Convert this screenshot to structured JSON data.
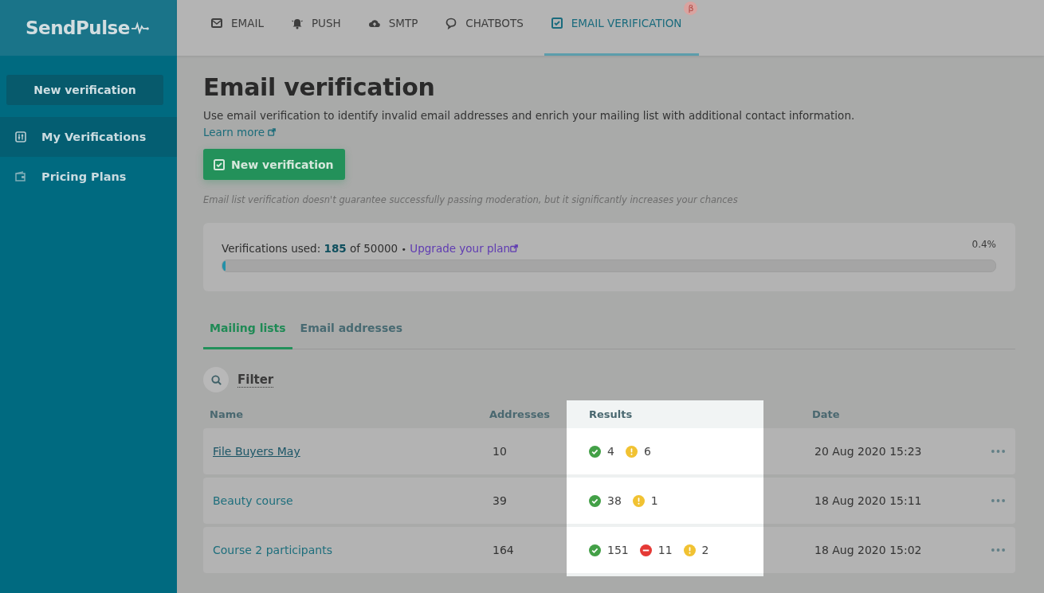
{
  "sidebar": {
    "logo": "SendPulse",
    "new_button": "New verification",
    "items": [
      {
        "label": "My Verifications",
        "selected": true
      },
      {
        "label": "Pricing Plans",
        "selected": false
      }
    ]
  },
  "top_nav": {
    "tabs": [
      {
        "label": "EMAIL",
        "selected": false
      },
      {
        "label": "PUSH",
        "selected": false
      },
      {
        "label": "SMTP",
        "selected": false
      },
      {
        "label": "CHATBOTS",
        "selected": false
      },
      {
        "label": "EMAIL VERIFICATION",
        "selected": true,
        "badge": "β"
      }
    ]
  },
  "page": {
    "title": "Email verification",
    "description": "Use email verification to identify invalid email addresses and enrich your mailing list with additional contact information.",
    "learn_more": "Learn more",
    "new_button": "New verification",
    "note": "Email list verification doesn't guarantee successfully passing moderation, but it significantly increases your chances"
  },
  "usage": {
    "label": "Verifications used:",
    "used": "185",
    "of": "of 50000",
    "separator": "•",
    "link": "Upgrade your plan",
    "percent": "0.4%",
    "level": 0.004
  },
  "tabs": [
    {
      "label": "Mailing lists",
      "selected": true
    },
    {
      "label": "Email addresses",
      "selected": false
    }
  ],
  "filter": "Filter",
  "table": {
    "columns": [
      "Name",
      "Addresses",
      "Results",
      "Date"
    ],
    "rows": [
      {
        "name": "File Buyers May",
        "hovered": true,
        "addresses": "10",
        "results": [
          {
            "kind": "valid",
            "count": "4"
          },
          {
            "kind": "risky",
            "count": "6"
          }
        ],
        "date": "20 Aug 2020 15:23"
      },
      {
        "name": "Beauty course",
        "hovered": false,
        "addresses": "39",
        "results": [
          {
            "kind": "valid",
            "count": "38"
          },
          {
            "kind": "risky",
            "count": "1"
          }
        ],
        "date": "18 Aug 2020 15:11"
      },
      {
        "name": "Course 2 participants",
        "hovered": false,
        "addresses": "164",
        "results": [
          {
            "kind": "valid",
            "count": "151"
          },
          {
            "kind": "invalid",
            "count": "11"
          },
          {
            "kind": "risky",
            "count": "2"
          }
        ],
        "date": "18 Aug 2020 15:02"
      }
    ]
  }
}
